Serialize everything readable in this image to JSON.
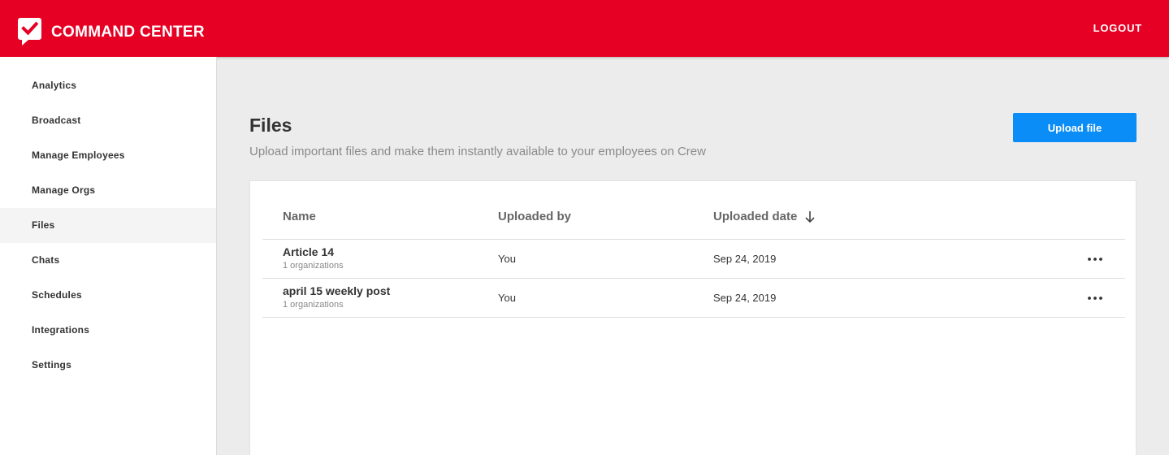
{
  "header": {
    "title": "COMMAND CENTER",
    "logout_label": "LOGOUT",
    "logo_icon": "check-chat-bubble-icon",
    "brand_color": "#e60023"
  },
  "sidebar": {
    "items": [
      {
        "label": "Analytics",
        "active": false
      },
      {
        "label": "Broadcast",
        "active": false
      },
      {
        "label": "Manage Employees",
        "active": false
      },
      {
        "label": "Manage Orgs",
        "active": false
      },
      {
        "label": "Files",
        "active": true
      },
      {
        "label": "Chats",
        "active": false
      },
      {
        "label": "Schedules",
        "active": false
      },
      {
        "label": "Integrations",
        "active": false
      },
      {
        "label": "Settings",
        "active": false
      }
    ]
  },
  "main": {
    "title": "Files",
    "subtitle": "Upload important files and make them instantly available to your employees on Crew",
    "upload_label": "Upload file",
    "accent_color": "#0a8df7"
  },
  "table": {
    "columns": [
      "Name",
      "Uploaded by",
      "Uploaded date"
    ],
    "sort_icon": "arrow-down-icon",
    "rows": [
      {
        "name": "Article 14",
        "orgs": "1 organizations",
        "uploaded_by": "You",
        "date": "Sep 24, 2019"
      },
      {
        "name": "april 15 weekly post",
        "orgs": "1 organizations",
        "uploaded_by": "You",
        "date": "Sep 24, 2019"
      }
    ]
  }
}
